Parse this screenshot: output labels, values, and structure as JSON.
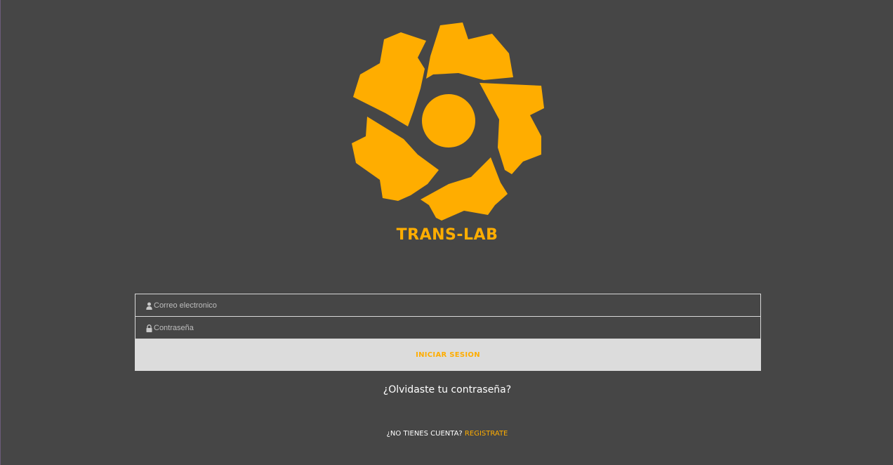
{
  "brand": {
    "name": "TRANS-LAB",
    "logo_icon": "gear-logo-icon",
    "accent_color": "#ffad00",
    "background_color": "#464646"
  },
  "login_form": {
    "email": {
      "placeholder": "Correo electronico",
      "icon": "user-icon",
      "value": ""
    },
    "password": {
      "placeholder": "Contraseña",
      "icon": "lock-icon",
      "value": ""
    },
    "submit_label": "INICIAR SESION"
  },
  "links": {
    "forgot_password": "¿Olvidaste tu contraseña?",
    "no_account_text": "¿NO TIENES CUENTA?",
    "register": "REGISTRATE"
  }
}
